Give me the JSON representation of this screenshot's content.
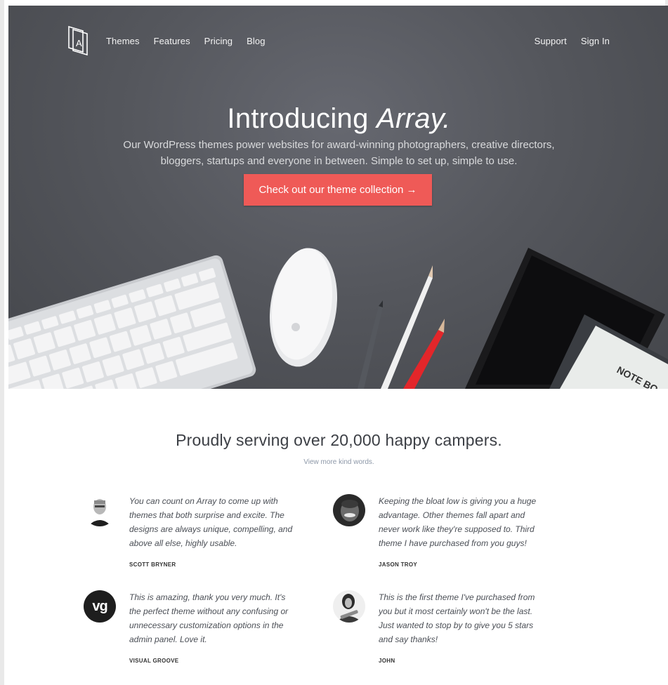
{
  "nav": {
    "logo_letter": "A",
    "left_links": [
      "Themes",
      "Features",
      "Pricing",
      "Blog"
    ],
    "right_links": [
      "Support",
      "Sign In"
    ]
  },
  "hero": {
    "title_plain": "Introducing ",
    "title_em": "Array.",
    "subtitle": "Our WordPress themes power websites for award-winning photographers, creative directors, bloggers, startups and everyone in between. Simple to set up, simple to use.",
    "cta_label": "Check out our theme collection →",
    "notebook_label": "NOTE BO",
    "cta_color": "#ef5a57"
  },
  "testimonials": {
    "headline": "Proudly serving over 20,000 happy campers.",
    "view_more": "View more kind words.",
    "items": [
      {
        "quote": "You can count on Array to come up with themes that both surprise and excite. The designs are always unique, compelling, and above all else, highly usable.",
        "author": "SCOTT BRYNER"
      },
      {
        "quote": "Keeping the bloat low is giving you a huge advantage. Other themes fall apart and never work like they're supposed to. Third theme I have purchased from you guys!",
        "author": "JASON TROY"
      },
      {
        "quote": "This is amazing, thank you very much. It's the perfect theme without any confusing or unnecessary customization options in the admin panel. Love it.",
        "author": "VISUAL GROOVE",
        "avatar_text": "vg"
      },
      {
        "quote": "This is the first theme I've purchased from you but it most certainly won't be the last. Just wanted to stop by to give you 5 stars and say thanks!",
        "author": "JOHN"
      }
    ]
  }
}
